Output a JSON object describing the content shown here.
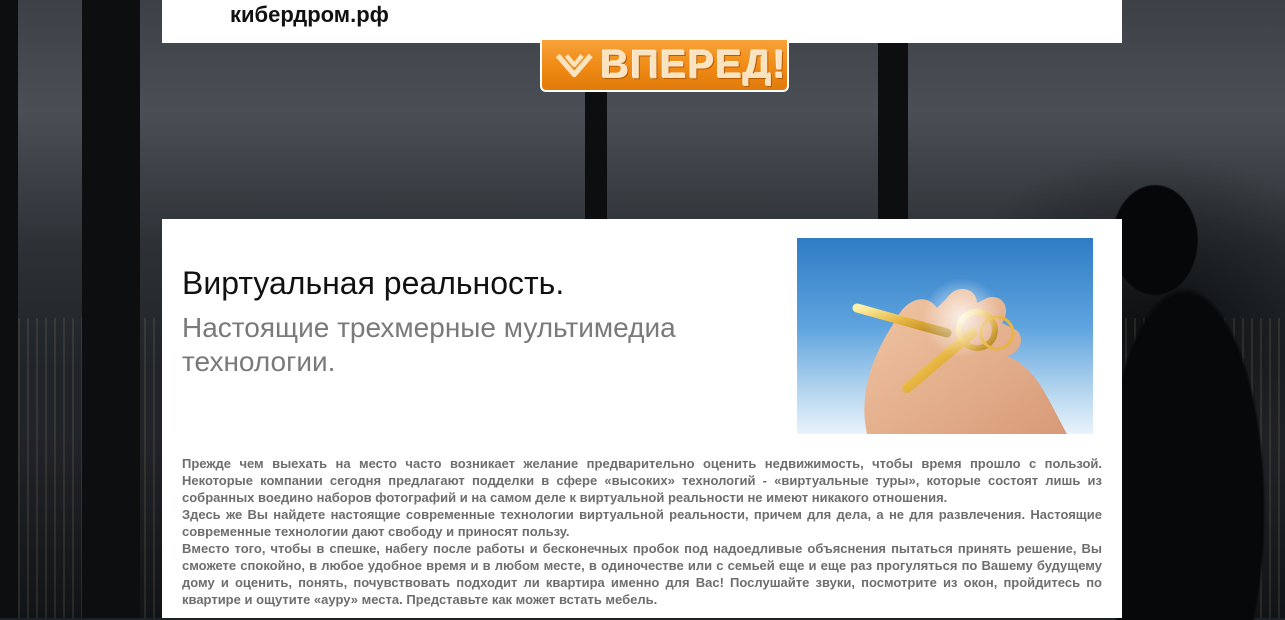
{
  "header": {
    "site_name": "кибердром.рф"
  },
  "go_button": {
    "label": "ВПЕРЕД!",
    "icon": "chevron-down-icon"
  },
  "main": {
    "title": "Виртуальная реальность.",
    "subtitle": "Настоящие трехмерные мультимедиа технологии.",
    "image": "hand-with-keys-photo",
    "paragraphs": [
      "Прежде чем выехать на место часто возникает желание предварительно оценить недвижимость, чтобы время прошло с пользой. Некоторые компании сегодня предлагают подделки в сфере «высоких» технологий - «виртуальные туры», которые состоят лишь из собранных воедино наборов фотографий и на самом деле к виртуальной реальности не имеют никакого отношения.",
      "Здесь же Вы найдете настоящие современные технологии виртуальной реальности, причем для дела, а не для развлечения. Настоящие современные технологии дают свободу и приносят пользу.",
      "Вместо того, чтобы в спешке, набегу после работы и бесконечных пробок под надоедливые объяснения пытаться принять решение, Вы сможете спокойно, в любое удобное время и в любом месте, в одиночестве или с семьей еще и еще раз прогуляться по Вашему будущему дому и оценить, понять, почувствовать подходит ли квартира именно для Вас! Послушайте звуки, посмотрите из окон, пройдитесь по квартире и ощутите «ауру» места. Представьте как может встать мебель."
    ]
  },
  "colors": {
    "accent": "#f08a14",
    "text_gray": "#6e6e6e",
    "subtitle_gray": "#7a7a7a"
  }
}
